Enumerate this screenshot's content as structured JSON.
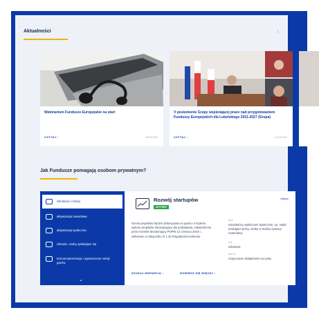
{
  "news": {
    "title": "Aktualności",
    "prev_arrow": "‹",
    "next_arrow": "›",
    "cards": [
      {
        "title": "Webinarium Fundusze Europejskie na start",
        "link": "CZYTAJ ›",
        "date": "28.03.2022"
      },
      {
        "title": "V posiedzenie Grupy wspierającej prace nad przygotowaniem Funduszy Europejskich dla Lubelskiego 2021-2027 (Grupa)",
        "link": "CZYTAJ ›",
        "date": "11.03.2022"
      }
    ]
  },
  "help": {
    "title": "Jak Fundusze pomagają osobom prywatnym?",
    "menu": [
      {
        "label": "szkolenia i rozwój",
        "icon": "training-icon"
      },
      {
        "label": "aktywizacja zawodowa",
        "icon": "briefcase-icon"
      },
      {
        "label": "aktywizacja społeczna",
        "icon": "people-icon"
      },
      {
        "label": "zdrowie, osoby opiekujące się",
        "icon": "health-icon"
      },
      {
        "label": "termomodernizacja i ograniczenie emisji gazów",
        "icon": "house-icon"
      }
    ],
    "more_chevron": "⌄"
  },
  "detail": {
    "title": "Rozwój startupów",
    "badge": "AKTYWNY",
    "save": "Zapisz",
    "description": "Ocena projektów będzie dokonywana w oparciu o kryteria wyboru projektów obowiązujące dla podziałania, zatwierdzone przez Komitet Monitorujący POPW 12 czerwca 2019 r., wskazane w załączniku nr 1 do Regulaminu konkursu",
    "for_label": "DLA",
    "for_value": "mieszkańcy wykluczeni społecznie, np. matki szukające pracy, osoby w trudnej sytuacji materialnej",
    "what_label": "CO",
    "what_value": "szkolenia",
    "for_what_label": "NA CO",
    "for_what_value": "rozpoczęcie działalności na rynku",
    "link_support": "SZUKAJ WSPARCIA ›",
    "link_more": "DOWIEDZ SIĘ WIĘCEJ ›"
  }
}
